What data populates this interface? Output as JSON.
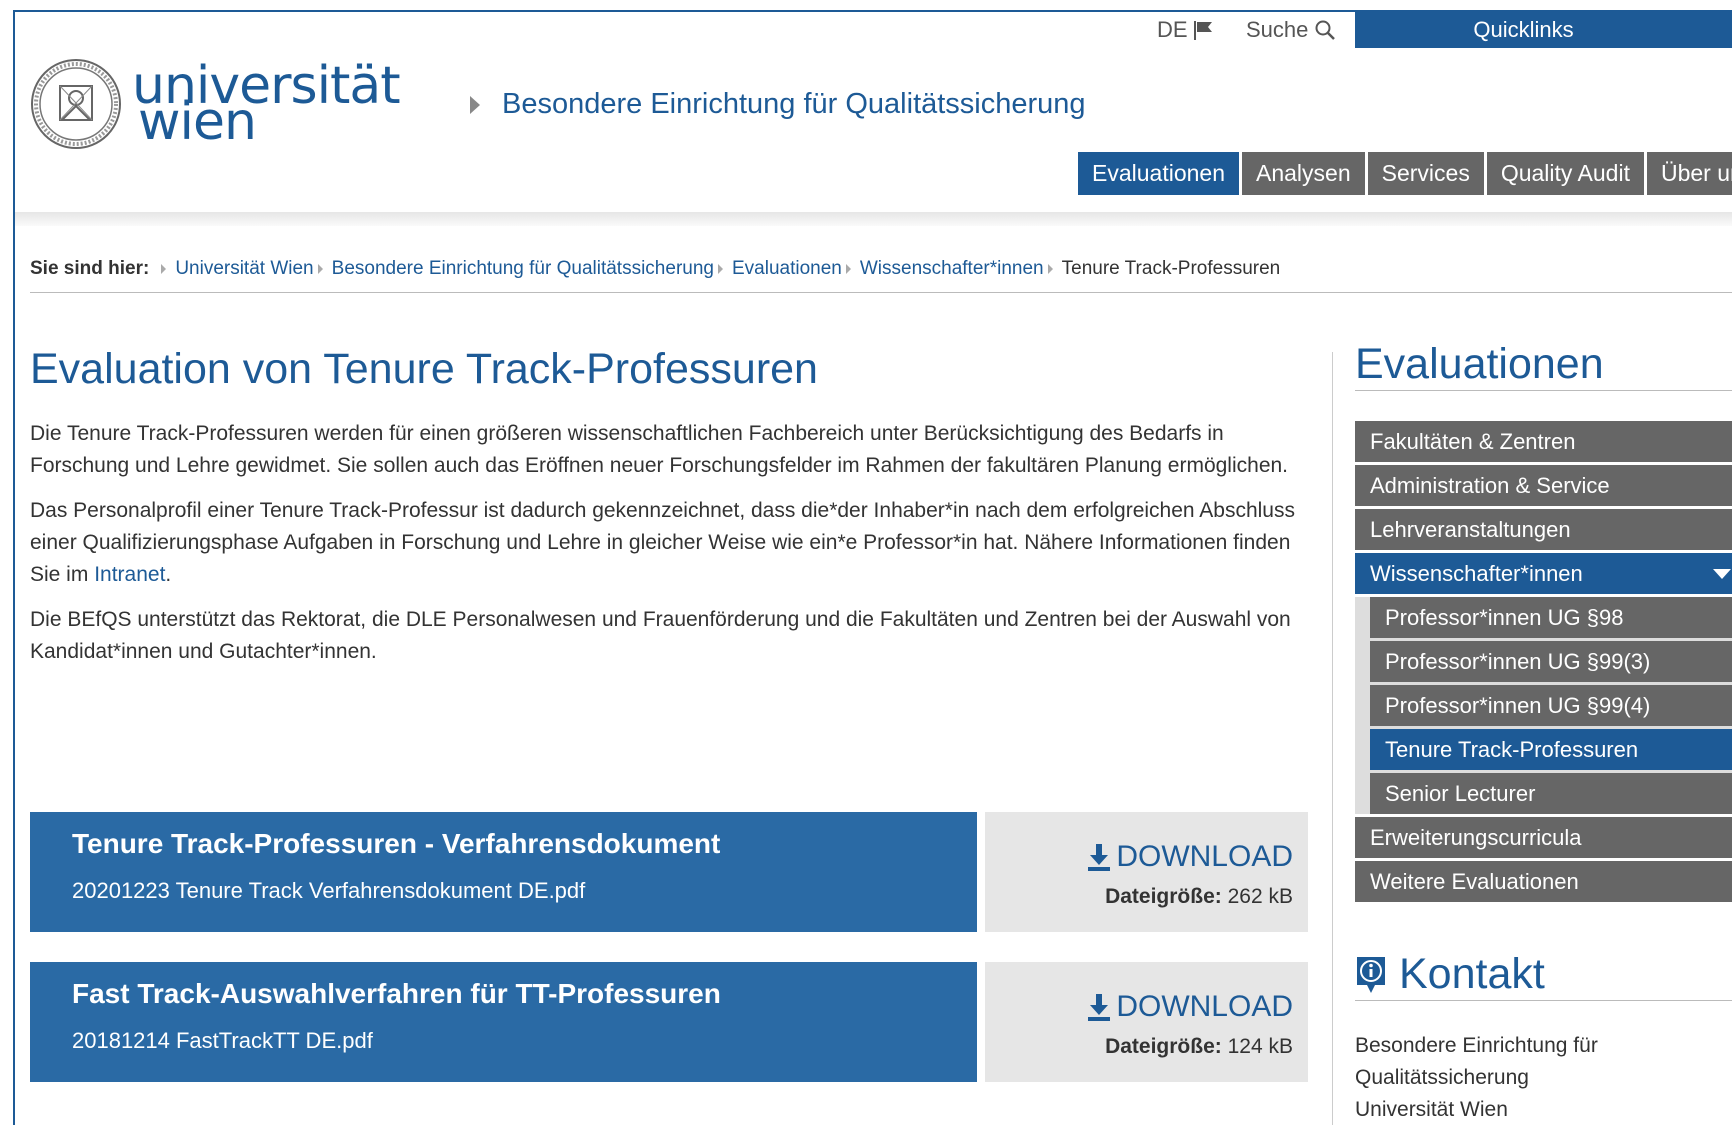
{
  "header": {
    "lang": "DE",
    "search_label": "Suche",
    "quicklinks": "Quicklinks",
    "logo_line1": "universität",
    "logo_line2": "wien",
    "department": "Besondere Einrichtung für Qualitätssicherung",
    "nav": [
      "Evaluationen",
      "Analysen",
      "Services",
      "Quality Audit",
      "Über uns"
    ]
  },
  "breadcrumb": {
    "lead": "Sie sind hier:",
    "links": [
      "Universität Wien",
      "Besondere Einrichtung für Qualitätssicherung",
      "Evaluationen",
      "Wissenschafter*innen"
    ],
    "current": "Tenure Track-Professuren"
  },
  "main": {
    "title": "Evaluation von Tenure Track-Professuren",
    "p1": "Die Tenure Track-Professuren werden für einen größeren wissenschaftlichen Fachbereich unter Berücksichtigung des Bedarfs in Forschung und Lehre gewidmet. Sie sollen auch das Eröffnen neuer Forschungsfelder im Rahmen der fakultären Planung ermöglichen.",
    "p2_before": "Das Personalprofil einer Tenure Track-Professur ist dadurch gekennzeichnet, dass die*der Inhaber*in nach dem erfolgreichen Abschluss einer Qualifizierungsphase Aufgaben in Forschung und Lehre in gleicher Weise wie ein*e Professor*in hat. Nähere Informationen finden Sie im ",
    "p2_link": "Intranet",
    "p2_after": ".",
    "p3": "Die BEfQS unterstützt das Rektorat, die DLE Personalwesen und Frauenförderung und die Fakultäten und Zentren bei der Auswahl von Kandidat*innen und Gutachter*innen.",
    "downloads": [
      {
        "title": "Tenure Track-Professuren - Verfahrensdokument",
        "file": "20201223 Tenure Track Verfahrensdokument DE.pdf",
        "download_label": "DOWNLOAD",
        "size_label": "Dateigröße:",
        "size": "262 kB"
      },
      {
        "title": "Fast Track-Auswahlverfahren für TT-Professuren",
        "file": "20181214 FastTrackTT DE.pdf",
        "download_label": "DOWNLOAD",
        "size_label": "Dateigröße:",
        "size": "124 kB"
      }
    ]
  },
  "sidebar": {
    "title": "Evaluationen",
    "items": [
      "Fakultäten & Zentren",
      "Administration & Service",
      "Lehrveranstaltungen",
      "Wissenschafter*innen",
      "Professor*innen UG §98",
      "Professor*innen UG §99(3)",
      "Professor*innen UG §99(4)",
      "Tenure Track-Professuren",
      "Senior Lecturer",
      "Erweiterungscurricula",
      "Weitere Evaluationen"
    ],
    "kontakt_title": "Kontakt",
    "address": [
      "Besondere Einrichtung für",
      "Qualitätssicherung",
      "Universität Wien"
    ]
  },
  "colors": {
    "brand": "#1d5a96",
    "nav_grey": "#666666",
    "download_bg": "#2a6aa5"
  }
}
